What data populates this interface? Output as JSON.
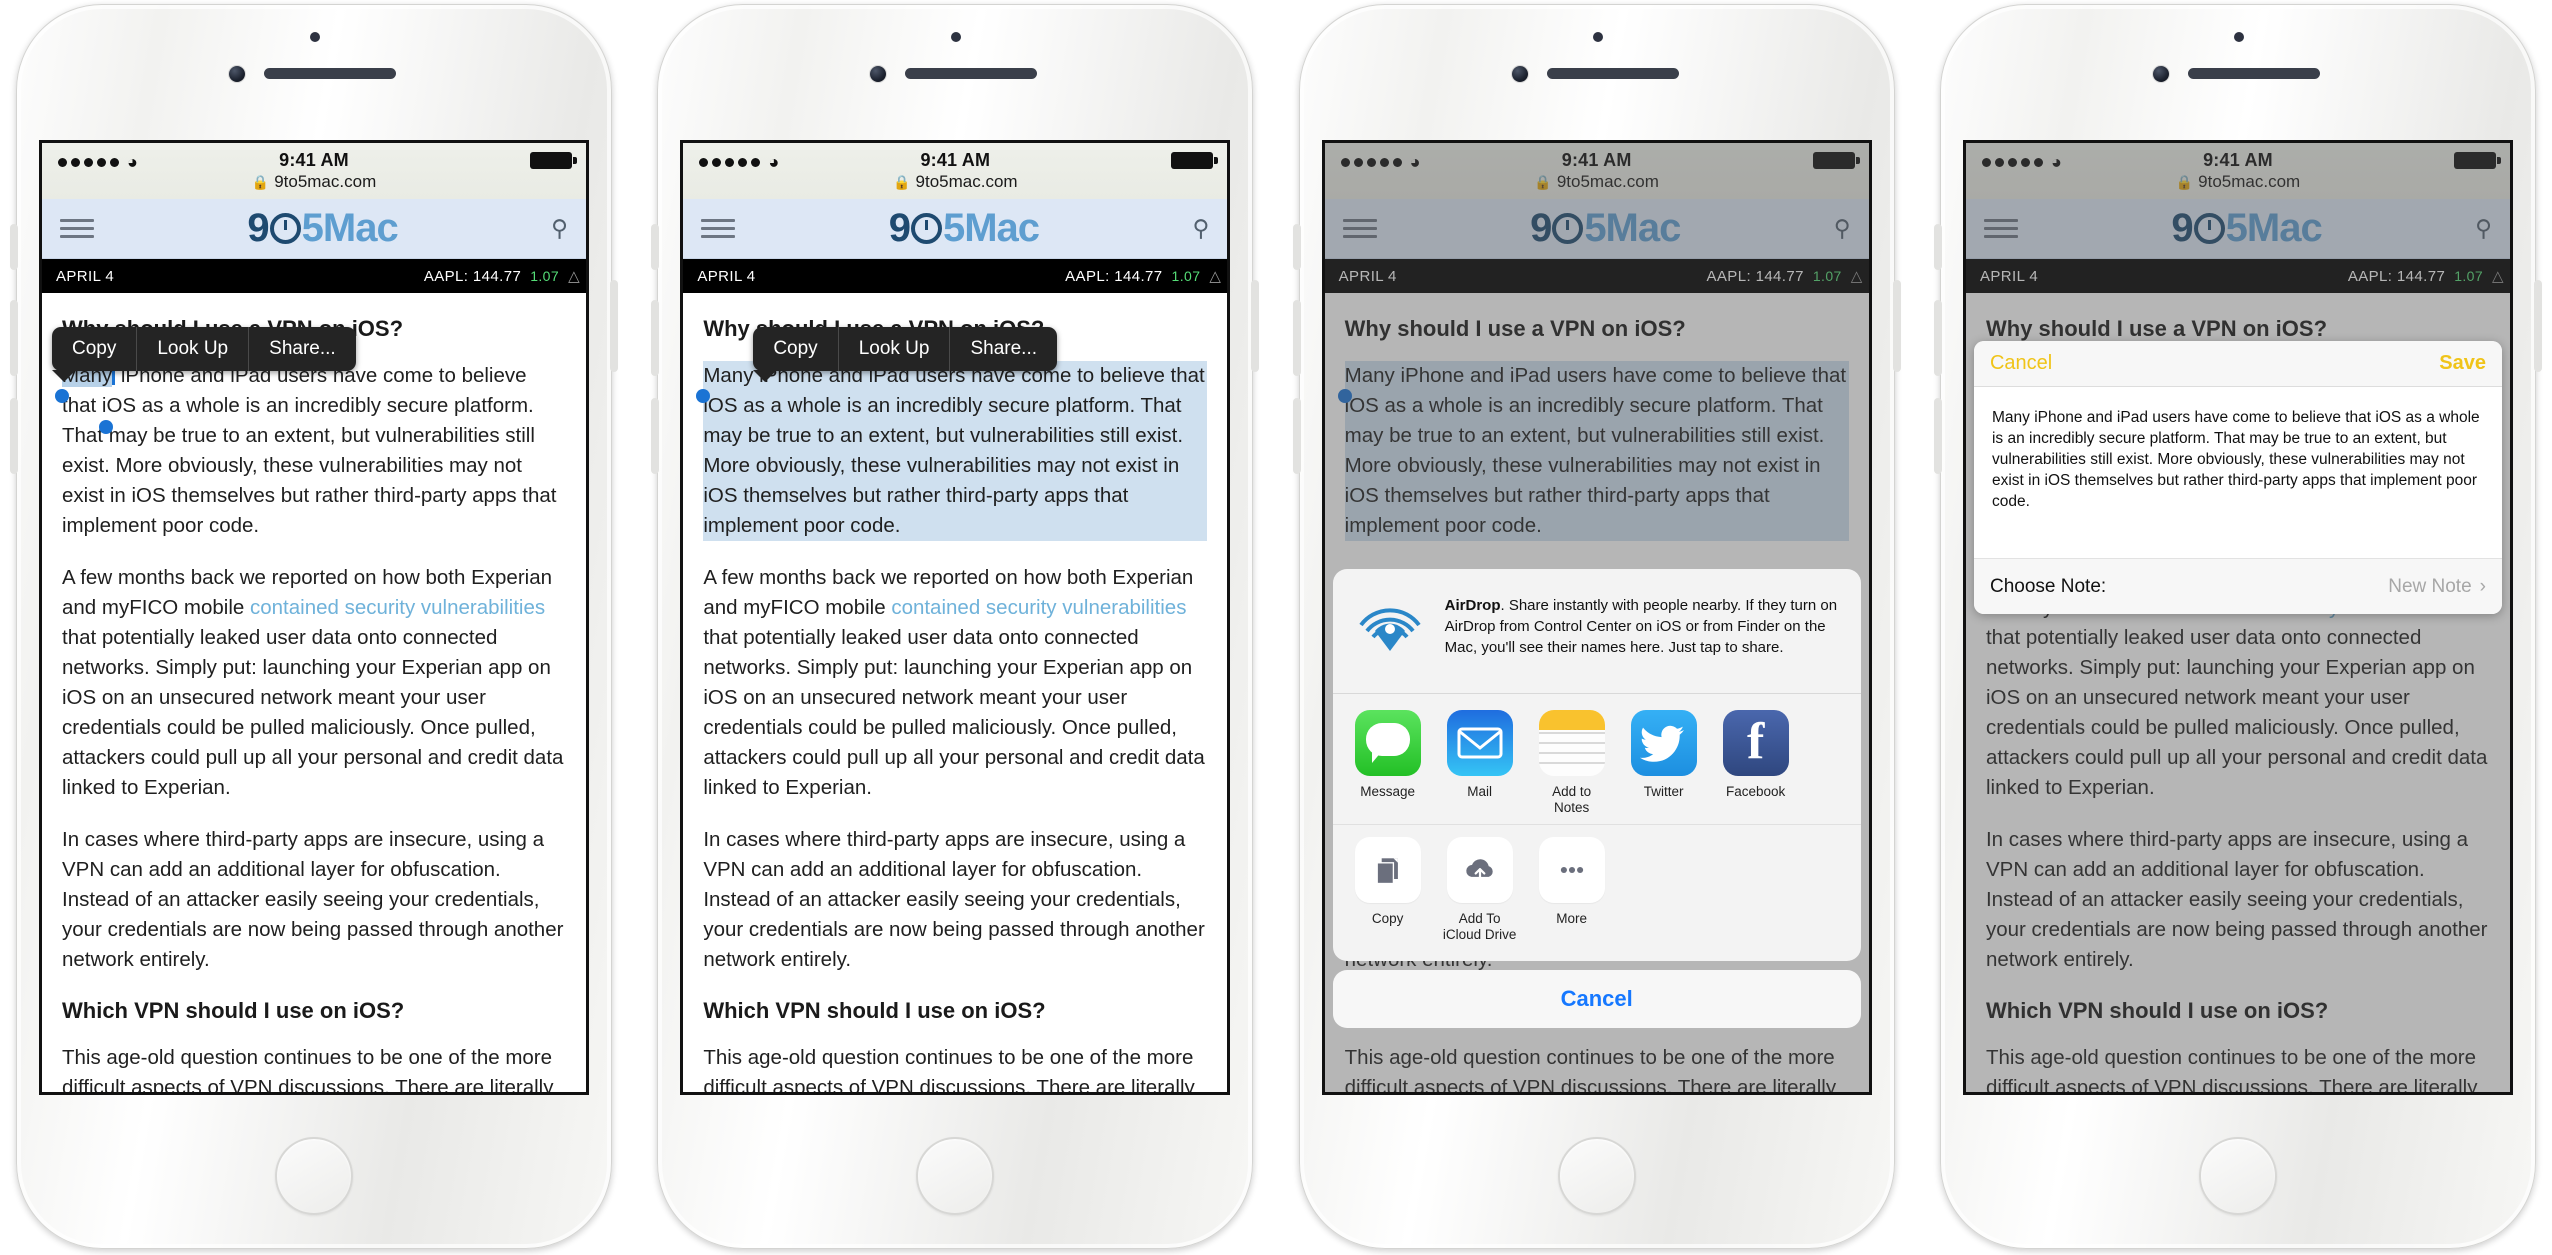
{
  "status_bar": {
    "signal_dots": 5,
    "wifi_icon": "wifi-icon",
    "time": "9:41 AM",
    "lock_icon": "lock-icon",
    "url": "9to5mac.com",
    "battery_icon": "battery-full-icon"
  },
  "site_header": {
    "menu_icon": "hamburger-menu-icon",
    "logo_left": "9",
    "logo_clock": "clock-icon",
    "logo_right": "5Mac",
    "search_icon": "search-icon"
  },
  "ticker": {
    "date": "APRIL 4",
    "symbol": "AAPL: 144.77",
    "change": "1.07",
    "caret_icon": "chevron-up-icon"
  },
  "callout": {
    "copy": "Copy",
    "look_up": "Look Up",
    "share": "Share..."
  },
  "article": {
    "heading_1": "Why should I use a VPN on iOS?",
    "paragraph_1_a": "Many",
    "paragraph_1_b": " iPhone and iPad users have come to believe that iOS as a whole is an incredibly secure platform. That may be true to an extent, but vulnerabilities still exist. More obviously, these vulnerabilities may not exist in iOS themselves but rather third-party apps that implement poor code.",
    "paragraph_1_full": "Many iPhone and iPad users have come to believe that iOS as a whole is an incredibly secure platform. That may be true to an extent, but vulnerabilities still exist. More obviously, these vulnerabilities may not exist in iOS themselves but rather third-party apps that implement poor code.",
    "paragraph_2_pre": "A few months back we reported on how both Experian and myFICO mobile ",
    "paragraph_2_link": "contained security vulnerabilities",
    "paragraph_2_post": " that potentially leaked user data onto connected networks. Simply put: launching your Experian app on iOS on an unsecured network meant your user credentials could be pulled maliciously. Once pulled, attackers could pull up all your personal and credit data linked to Experian.",
    "paragraph_3": "In cases where third-party apps are insecure, using a VPN can add an additional layer for obfuscation. Instead of an attacker easily seeing your credentials, your credentials are now being passed through another network entirely.",
    "heading_2": "Which VPN should I use on iOS?",
    "paragraph_4": "This age-old question continues to be one of the more difficult aspects of VPN discussions. There are literally"
  },
  "share_sheet": {
    "airdrop_icon": "airdrop-icon",
    "airdrop_title": "AirDrop",
    "airdrop_text": ". Share instantly with people nearby. If they turn on AirDrop from Control Center on iOS or from Finder on the Mac, you'll see their names here. Just tap to share.",
    "apps": [
      {
        "label": "Message",
        "icon": "messages-icon",
        "color": "#3ecf4a"
      },
      {
        "label": "Mail",
        "icon": "mail-icon",
        "color": "#1d8fe8"
      },
      {
        "label": "Add to Notes",
        "icon": "notes-icon",
        "color": "#f8c12c"
      },
      {
        "label": "Twitter",
        "icon": "twitter-icon",
        "color": "#2aa3ef"
      },
      {
        "label": "Facebook",
        "icon": "facebook-icon",
        "color": "#3b5998"
      }
    ],
    "actions": [
      {
        "label": "Copy",
        "icon": "copy-icon"
      },
      {
        "label": "Add To\niCloud Drive",
        "label_line1": "Add To",
        "label_line2": "iCloud Drive",
        "icon": "icloud-upload-icon"
      },
      {
        "label": "More",
        "icon": "more-dots-icon"
      }
    ],
    "cancel": "Cancel"
  },
  "note_dialog": {
    "cancel": "Cancel",
    "save": "Save",
    "body": "Many iPhone and iPad users have come to believe that iOS as a whole is an incredibly secure platform. That may be true to an extent, but vulnerabilities still exist. More obviously, these vulnerabilities may not exist in iOS themselves but rather third-party apps that implement poor code.",
    "choose_label": "Choose Note:",
    "choose_value": "New Note",
    "chevron_icon": "chevron-right-icon"
  },
  "colors": {
    "accent_blue": "#1678ff",
    "selection": "#cfe0ef",
    "link": "#6fb2da",
    "note_yellow": "#f0c419"
  }
}
